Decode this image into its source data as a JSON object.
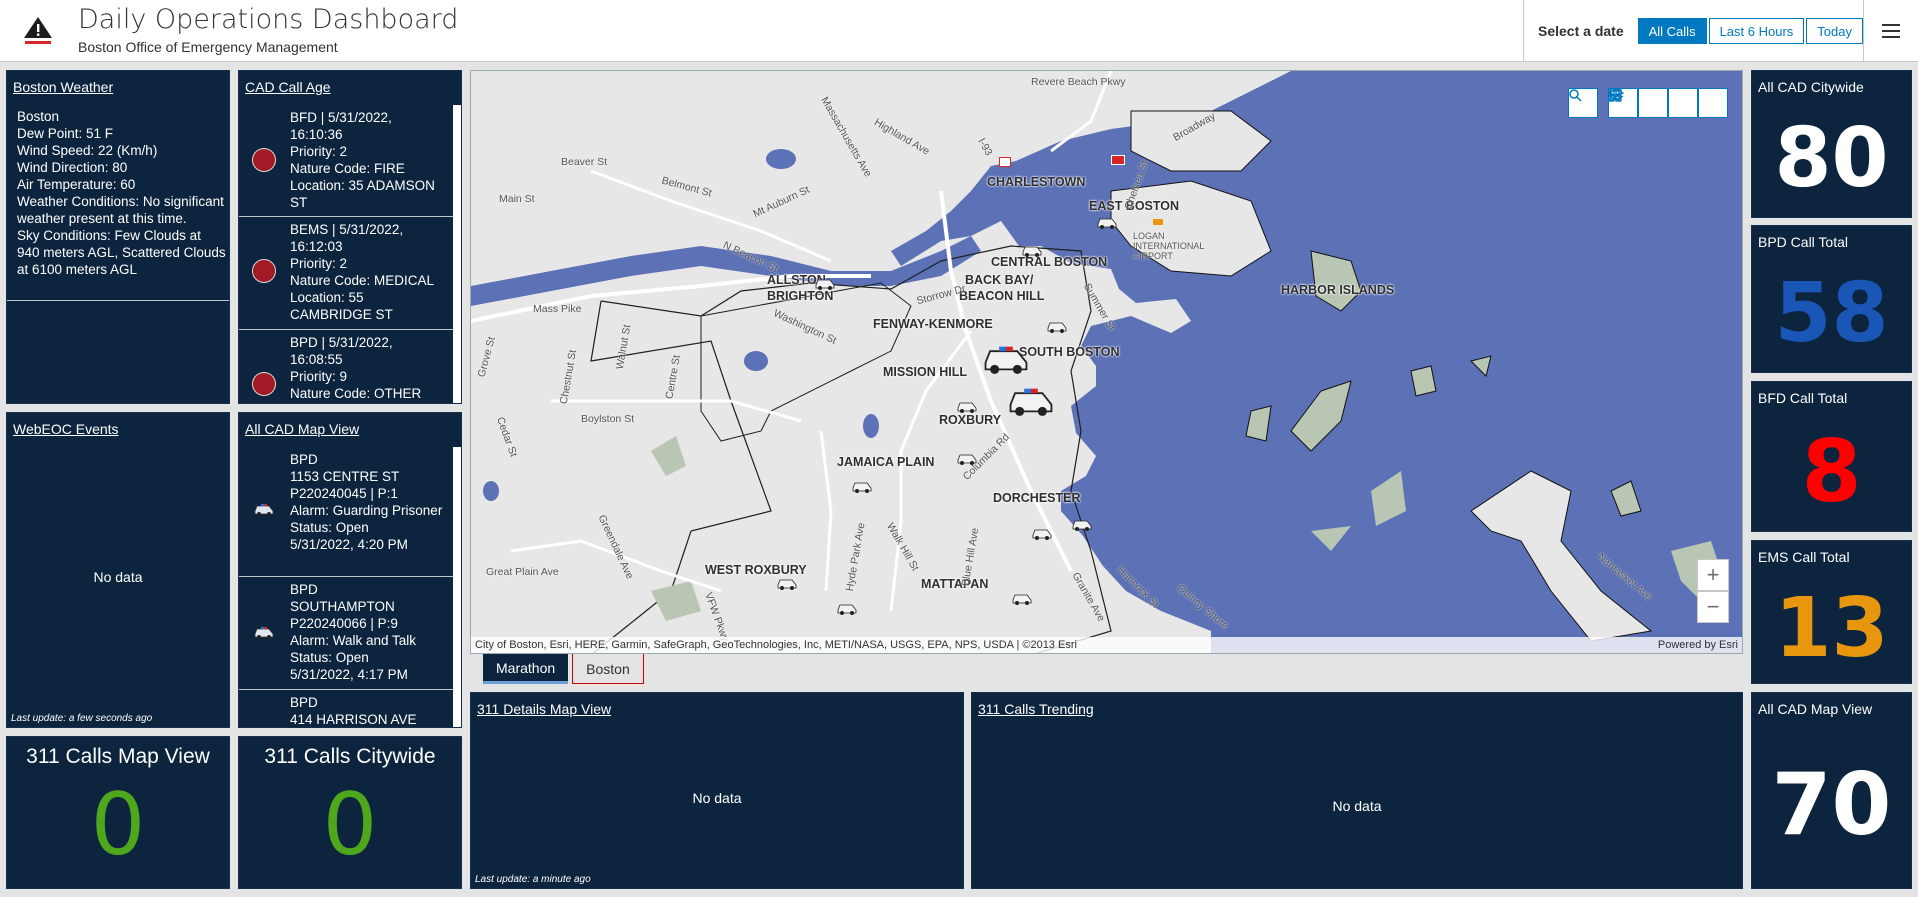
{
  "header": {
    "title": "Daily Operations Dashboard",
    "subtitle": "Boston Office of Emergency Management",
    "date_label": "Select a date",
    "date_options": [
      "All Calls",
      "Last 6 Hours",
      "Today"
    ],
    "selected_date": "All Calls",
    "accent_color": "#0079c1"
  },
  "weather": {
    "title": "Boston Weather",
    "lines": [
      "Boston",
      "Dew Point: 51 F",
      "Wind Speed: 22 (Km/h)",
      "Wind Direction: 80",
      "Air Temperature: 60",
      "Weather Conditions: No significant weather present at this time.",
      "Sky Conditions: Few Clouds at 940 meters AGL, Scattered Clouds at 6100 meters AGL"
    ]
  },
  "cad_call_age": {
    "title": "CAD Call Age",
    "items": [
      {
        "header": "BFD  | 5/31/2022, 16:10:36",
        "priority": "Priority: 2",
        "nature": "Nature Code: FIRE",
        "location": "Location: 35 ADAMSON ST"
      },
      {
        "header": "BEMS  | 5/31/2022, 16:12:03",
        "priority": "Priority: 2",
        "nature": "Nature Code: MEDICAL",
        "location": "Location: 55 CAMBRIDGE ST"
      },
      {
        "header": "BPD  | 5/31/2022, 16:08:55",
        "priority": "Priority: 9",
        "nature": "Nature Code: OTHER",
        "location": ""
      }
    ]
  },
  "webeoc": {
    "title": "WebEOC Events",
    "empty": "No data",
    "last_update": "Last update: a few seconds ago"
  },
  "cad_map_list": {
    "title": "All CAD Map View",
    "items": [
      {
        "agency": "BPD",
        "address": "1153 CENTRE ST",
        "id": "P220240045 | P:1",
        "alarm": "Alarm: Guarding Prisoner",
        "status": "Status: Open",
        "time": "5/31/2022, 4:20 PM"
      },
      {
        "agency": "BPD",
        "address": "SOUTHAMPTON",
        "id": "P220240066 | P:9",
        "alarm": "Alarm: Walk and Talk",
        "status": "Status: Open",
        "time": "5/31/2022, 4:17 PM"
      },
      {
        "agency": "BPD",
        "address": "414 HARRISON AVE",
        "id": "",
        "alarm": "",
        "status": "",
        "time": ""
      }
    ]
  },
  "calls_311_map": {
    "title": "311 Calls Map View",
    "value": "0"
  },
  "calls_311_citywide": {
    "title": "311 Calls Citywide",
    "value": "0"
  },
  "map": {
    "toolbar": [
      "search-icon",
      "bookmark-icon",
      "legend-icon",
      "layers-icon",
      "qr-code-icon"
    ],
    "attribution": "City of Boston, Esri, HERE, Garmin, SafeGraph, GeoTechnologies, Inc, METI/NASA, USGS, EPA, NPS, USDA | ©2013 Esri",
    "powered_by": "Powered by Esri",
    "neighborhoods": [
      "CHARLESTOWN",
      "EAST BOSTON",
      "CENTRAL BOSTON",
      "ALLSTON",
      "BRIGHTON",
      "BACK BAY/",
      "BEACON HILL",
      "FENWAY-KENMORE",
      "SOUTH BOSTON",
      "MISSION HILL",
      "ROXBURY",
      "JAMAICA PLAIN",
      "DORCHESTER",
      "HARBOR ISLANDS",
      "WEST ROXBURY",
      "MATTAPAN",
      "LOGAN INTERNATIONAL AIRPORT"
    ],
    "streets": [
      "Revere Beach Pkwy",
      "Broadway",
      "Highland Ave",
      "Beaver St",
      "Belmont St",
      "Mt Auburn St",
      "Main St",
      "N Beacon St",
      "Mass Pike",
      "Boylston St",
      "Washington St",
      "Chestnut St",
      "Walnut St",
      "Centre St",
      "Cedar St",
      "Grove St",
      "Columbia Rd",
      "Walk Hill St",
      "Blue Hill Ave",
      "Hyde Park Ave",
      "Hancock St",
      "Quincy Shore",
      "Nantasket Ave",
      "Great Plain Ave",
      "Greendale Ave",
      "Summer St",
      "Chelsea St",
      "Granite Ave",
      "Massachusetts Ave",
      "Storrow Dr",
      "I-93",
      "VFW Pkwy"
    ],
    "water_color": "#5c71b6",
    "land_color": "#e7e7e7"
  },
  "map_tabs": [
    "Marathon",
    "Boston"
  ],
  "active_tab": "Marathon",
  "details_311": {
    "title": "311 Details Map View",
    "empty": "No data",
    "last_update": "Last update: a minute ago"
  },
  "trending_311": {
    "title": "311 Calls Trending",
    "empty": "No data"
  },
  "indicators": [
    {
      "title": "All CAD Citywide",
      "value": "80",
      "color": "#ffffff"
    },
    {
      "title": "BPD Call Total",
      "value": "58",
      "color": "#1a56b5"
    },
    {
      "title": "BFD Call Total",
      "value": "8",
      "color": "#ff0000"
    },
    {
      "title": "EMS Call Total",
      "value": "13",
      "color": "#e8960e"
    },
    {
      "title": "All CAD Map View",
      "value": "70",
      "color": "#ffffff"
    }
  ]
}
